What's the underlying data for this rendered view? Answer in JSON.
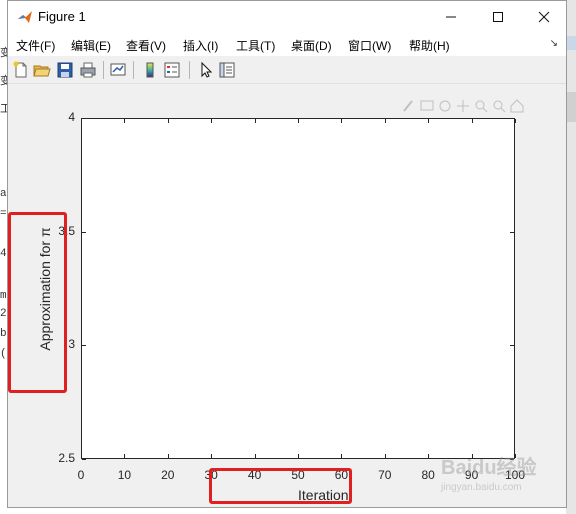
{
  "window": {
    "title": "Figure 1"
  },
  "menubar": {
    "items": [
      "文件(F)",
      "编辑(E)",
      "查看(V)",
      "插入(I)",
      "工具(T)",
      "桌面(D)",
      "窗口(W)",
      "帮助(H)"
    ]
  },
  "toolbar": {
    "icons": [
      "new-figure-icon",
      "open-file-icon",
      "save-icon",
      "print-icon",
      "link-plot-icon",
      "colorbar-icon",
      "legend-icon",
      "edit-plot-arrow-icon",
      "property-inspector-icon"
    ]
  },
  "background_text": {
    "left_chars": [
      "变",
      "变",
      "工",
      "a",
      "=",
      "4",
      "m",
      "2",
      "b",
      "("
    ]
  },
  "chart_data": {
    "type": "line",
    "title": "",
    "xlabel": "Iteration",
    "ylabel": "Approximation for π",
    "xlim": [
      0,
      100
    ],
    "ylim": [
      2.5,
      4
    ],
    "xticks": [
      "0",
      "10",
      "20",
      "30",
      "40",
      "50",
      "60",
      "70",
      "80",
      "90",
      "100"
    ],
    "yticks": [
      "4",
      "3.5",
      "3",
      "2.5"
    ],
    "series": [
      {
        "x": [],
        "y": []
      }
    ],
    "grid": false
  },
  "annotations": {
    "highlight_color": "#e02020"
  },
  "watermark": {
    "text": "Baidu经验",
    "subtext": "jingyan.baidu.com"
  }
}
